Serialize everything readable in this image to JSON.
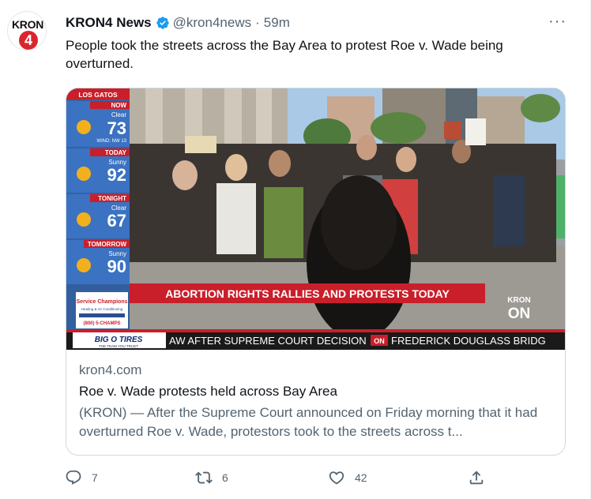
{
  "tweet": {
    "avatar_alt": "KRON",
    "avatar_number": "4",
    "display_name": "KRON4 News",
    "handle": "@kron4news",
    "separator": "·",
    "time": "59m",
    "more": "···",
    "text": "People took the streets across the Bay Area to protest Roe v. Wade being overturned."
  },
  "media": {
    "weather": {
      "location": "LOS GATOS",
      "blocks": [
        {
          "label": "NOW",
          "cond": "Clear",
          "temp": "73",
          "extra": "WIND: NW 13"
        },
        {
          "label": "TODAY",
          "cond": "Sunny",
          "temp": "92",
          "extra": ""
        },
        {
          "label": "TONIGHT",
          "cond": "Clear",
          "temp": "67",
          "extra": ""
        },
        {
          "label": "TOMORROW",
          "cond": "Sunny",
          "temp": "90",
          "extra": ""
        }
      ],
      "sponsor_name": "Service Champions",
      "sponsor_sub": "Heating & Air Conditioning",
      "sponsor_phone": "(800) 5-CHAMPS"
    },
    "headline": "ABORTION RIGHTS RALLIES AND PROTESTS TODAY",
    "station_top": "KRON",
    "station_bottom": "ON",
    "ticker_logo": "BIG O TIRES",
    "ticker_logo_sub": "THE TEAM YOU TRUST",
    "ticker_text": "AW AFTER SUPREME COURT DECISION",
    "ticker_badge": "ON",
    "ticker_text2": "FREDERICK DOUGLASS BRIDG"
  },
  "card": {
    "domain": "kron4.com",
    "title": "Roe v. Wade protests held across Bay Area",
    "description": "(KRON) — After the Supreme Court announced on Friday morning that it had overturned Roe v. Wade, protestors took to the streets across t..."
  },
  "actions": {
    "replies": "7",
    "retweets": "6",
    "likes": "42"
  },
  "colors": {
    "accent": "#1d9bf0",
    "muted": "#536471",
    "kron_red": "#d9262c"
  }
}
